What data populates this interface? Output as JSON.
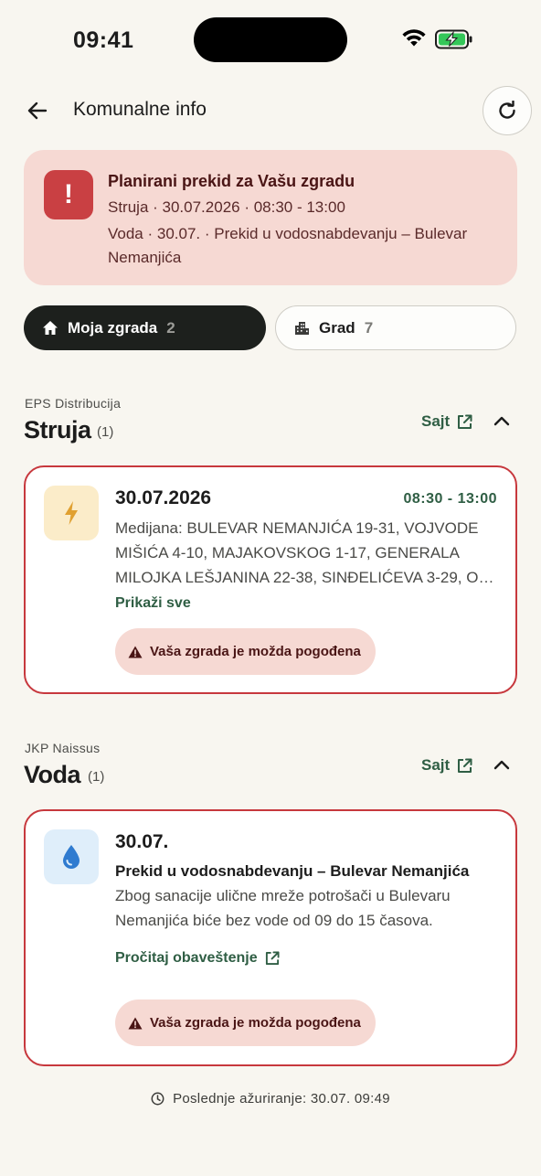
{
  "status_bar": {
    "time": "09:41"
  },
  "header": {
    "title": "Komunalne info"
  },
  "alert": {
    "title": "Planirani prekid za Vašu zgradu",
    "line1": "Struja · 30.07.2026 · 08:30 - 13:00",
    "line2": "Voda · 30.07. · Prekid u vodosnabdevanju – Bulevar Nemanjića"
  },
  "tabs": [
    {
      "label": "Moja zgrada",
      "count": "2"
    },
    {
      "label": "Grad",
      "count": "7"
    }
  ],
  "sections": {
    "power": {
      "provider": "EPS Distribucija",
      "title": "Struja",
      "count": "(1)",
      "site_label": "Sajt",
      "card": {
        "date": "30.07.2026",
        "time_range": "08:30 - 13:00",
        "description": "Medijana: BULEVAR NEMANJIĆA 19-31, VOJVODE MIŠIĆA 4-10, MAJAKOVSKOG 1-17, GENERALA MILOJKA LEŠJANINA 22-38, SINĐELIĆEVA 3-29, O…",
        "show_all": "Prikaži sve",
        "badge": "Vaša zgrada je možda pogođena"
      }
    },
    "water": {
      "provider": "JKP Naissus",
      "title": "Voda",
      "count": "(1)",
      "site_label": "Sajt",
      "card": {
        "date": "30.07.",
        "subtitle": "Prekid u vodosnabdevanju – Bulevar Nemanjića",
        "description": "Zbog sanacije ulične mreže potrošači u Bulevaru Nemanjića biće bez vode od 09 do 15 časova.",
        "read_notice": "Pročitaj obaveštenje",
        "badge": "Vaša zgrada je možda pogođena"
      }
    }
  },
  "footer": {
    "last_updated": "Poslednje ažuriranje: 30.07. 09:49"
  },
  "colors": {
    "accent_green": "#2f5e44",
    "alert_red": "#c94043",
    "alert_bg": "#f6d9d3",
    "power_icon_bg": "#fbecc9",
    "water_icon_bg": "#dfeefa"
  }
}
